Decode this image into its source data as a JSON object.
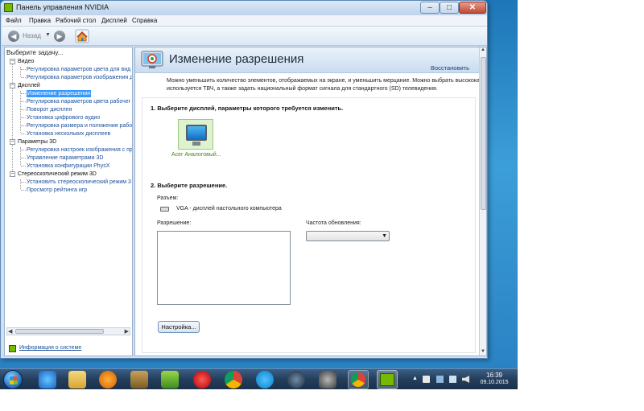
{
  "window": {
    "title": "Панель управления NVIDIA",
    "buttons": {
      "minimize": "–",
      "maximize": "□",
      "close": "✕"
    }
  },
  "menu": [
    "Файл",
    "Правка",
    "Рабочий стол",
    "Дисплей",
    "Справка"
  ],
  "toolbar": {
    "back_label": "Назад"
  },
  "left_panel": {
    "header": "Выберите задачу...",
    "tree": [
      {
        "label": "Видео",
        "type": "category"
      },
      {
        "label": "Регулировка параметров цвета для вид",
        "type": "item"
      },
      {
        "label": "Регулировка параметров изображения д",
        "type": "item"
      },
      {
        "label": "Дисплей",
        "type": "category"
      },
      {
        "label": "Изменение разрешения",
        "type": "item",
        "selected": true
      },
      {
        "label": "Регулировка параметров цвета рабочег",
        "type": "item"
      },
      {
        "label": "Поворот дисплея",
        "type": "item"
      },
      {
        "label": "Установка цифрового аудио",
        "type": "item"
      },
      {
        "label": "Регулировка размера и положения рабо",
        "type": "item"
      },
      {
        "label": "Установка нескольких дисплеев",
        "type": "item"
      },
      {
        "label": "Параметры 3D",
        "type": "category"
      },
      {
        "label": "Регулировка настроек изображения с пр",
        "type": "item"
      },
      {
        "label": "Управление параметрами 3D",
        "type": "item"
      },
      {
        "label": "Установка конфигурации PhysX",
        "type": "item"
      },
      {
        "label": "Стереоскопический режим 3D",
        "type": "category"
      },
      {
        "label": "Установить стереоскопический режим 3",
        "type": "item"
      },
      {
        "label": "Просмотр рейтинга игр",
        "type": "item"
      }
    ],
    "system_info_link": "Информация о системе"
  },
  "main": {
    "title": "Изменение разрешения",
    "restore_link": "Восстановить",
    "description_line1": "Можно уменьшить количество элементов, отображаемых на экране, и уменьшить мерцание. Можно выбрать высокока",
    "description_line2": "используется ТВЧ, а также задать национальный формат сигнала для стандартного (SD) телевидения.",
    "section1_title": "1. Выберите дисплей, параметры которого требуется изменить.",
    "display_label": "Acer Аналоговый...",
    "section2_title": "2. Выберите разрешение.",
    "connector_label": "Разъем:",
    "connector_value": "VGA - дисплей настольного компьютера",
    "resolution_label": "Разрешение:",
    "refresh_label": "Частота обновления:",
    "refresh_value": "",
    "settings_button": "Настройка..."
  },
  "taskbar": {
    "clock_time": "16:39",
    "clock_date": "09.10.2015"
  }
}
